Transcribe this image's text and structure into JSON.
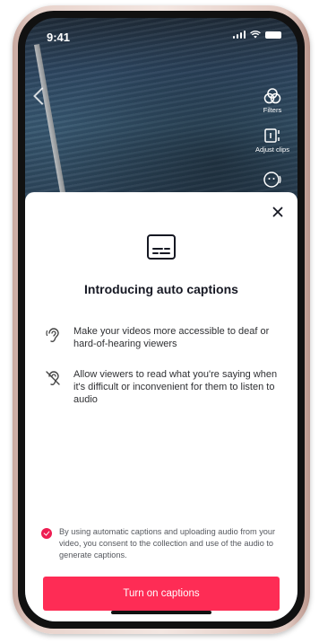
{
  "status": {
    "time": "9:41"
  },
  "video_tools": {
    "filters_label": "Filters",
    "adjust_label": "Adjust clips"
  },
  "sheet": {
    "title": "Introducing auto captions",
    "features": [
      {
        "icon": "ear-icon",
        "text": "Make your videos more accessible to deaf or hard-of-hearing viewers"
      },
      {
        "icon": "muted-ear-icon",
        "text": "Allow viewers to read what you're saying when it's difficult or inconvenient for them to listen to audio"
      }
    ],
    "consent_text": "By using automatic captions and uploading audio from your video, you consent to the collection and use of the audio to generate captions.",
    "consent_checked": true,
    "cta_label": "Turn on captions"
  },
  "colors": {
    "accent": "#fe2c55",
    "check": "#ee1d52"
  }
}
